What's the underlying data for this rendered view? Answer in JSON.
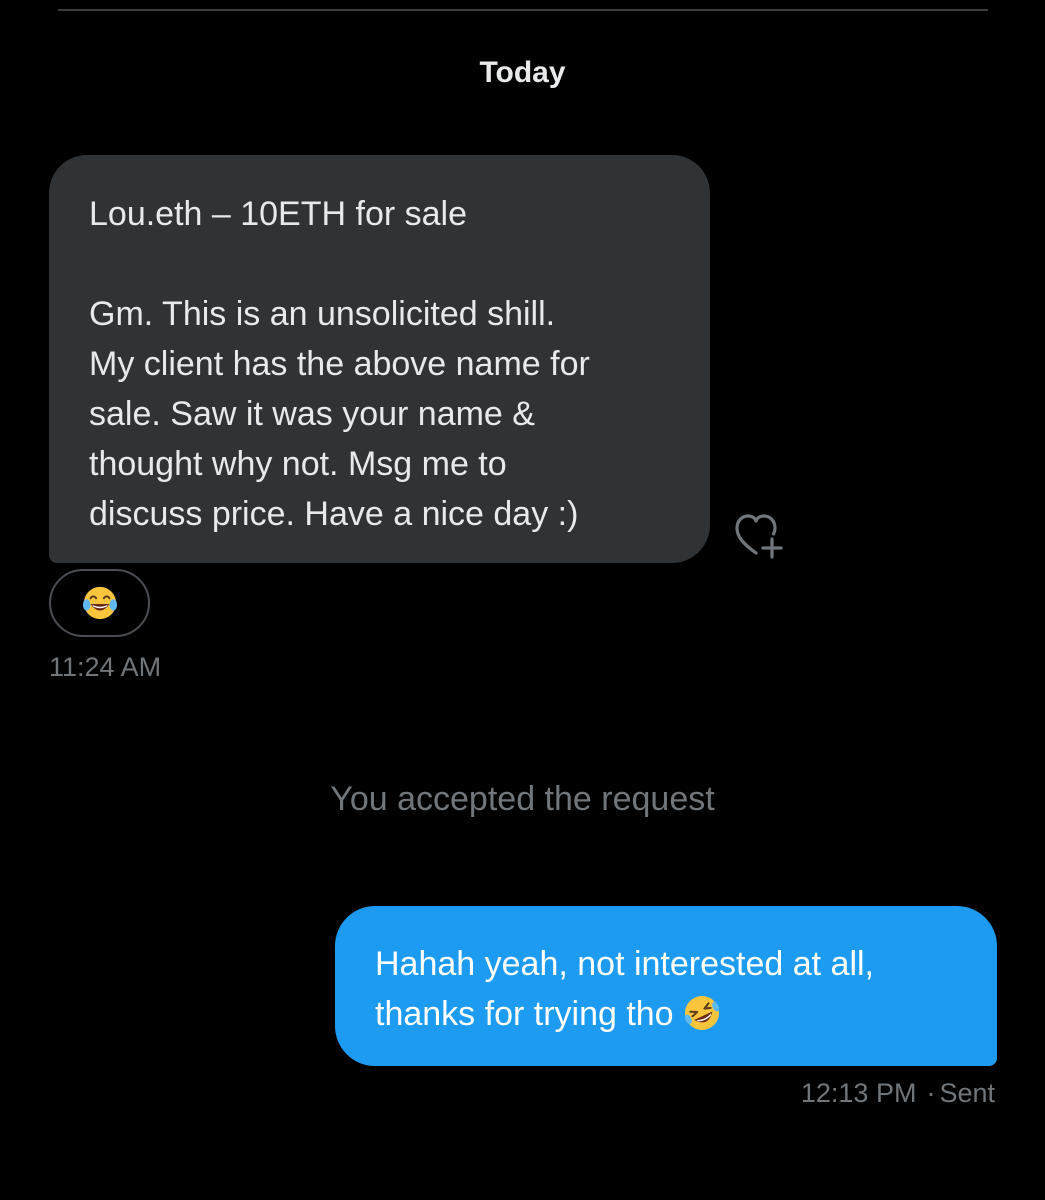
{
  "conversation": {
    "date_separator": "Today",
    "incoming_message": {
      "lines": [
        "Lou.eth – 10ETH for sale",
        "Gm. This is an unsolicited shill.",
        "My client has the above name for",
        "sale. Saw it was your name &",
        "thought why not. Msg me to",
        "discuss price. Have a nice day :)"
      ],
      "reaction_emoji": "face-with-tears-of-joy",
      "time": "11:24 AM"
    },
    "system_message": "You accepted the request",
    "outgoing_message": {
      "lines": [
        "Hahah yeah, not interested at all,",
        "thanks for trying tho"
      ],
      "emoji": "rolling-on-floor-laughing",
      "time": "12:13 PM",
      "separator": "·",
      "status": "Sent"
    }
  },
  "icons": {
    "add_reaction": "heart-plus-icon"
  },
  "colors": {
    "background": "#000000",
    "incoming_bubble": "#2f3336",
    "outgoing_bubble": "#1d9bf0",
    "secondary_text": "#71767b",
    "primary_text": "#e7e9ea"
  }
}
